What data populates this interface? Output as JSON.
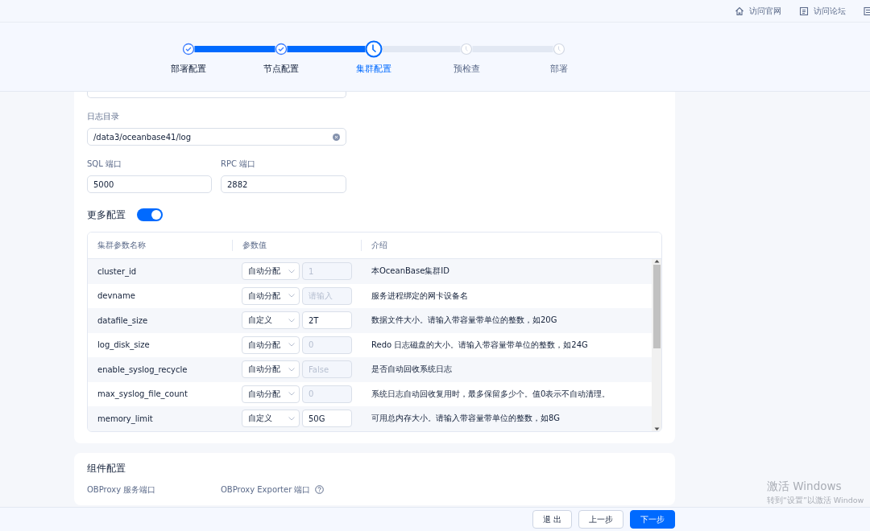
{
  "top_links": [
    {
      "label": "访问官网"
    },
    {
      "label": "访问论坛"
    }
  ],
  "steps": [
    {
      "label": "部署配置",
      "completed": true,
      "selected": false
    },
    {
      "label": "节点配置",
      "completed": true,
      "selected": false
    },
    {
      "label": "集群配置",
      "completed": false,
      "selected": true
    },
    {
      "label": "预检查",
      "completed": false,
      "selected": false
    },
    {
      "label": "部署",
      "completed": false,
      "selected": false
    }
  ],
  "cluster_form": {
    "log_dir": {
      "label": "日志目录",
      "value": "/data3/oceanbase41/log"
    },
    "sql_port": {
      "label": "SQL 端口",
      "value": "5000"
    },
    "rpc_port": {
      "label": "RPC 端口",
      "value": "2882"
    },
    "more_config": {
      "label": "更多配置",
      "on": true
    }
  },
  "params_table": {
    "columns": [
      "集群参数名称",
      "参数值",
      "介绍"
    ],
    "rows": [
      {
        "name": "cluster_id",
        "mode": "自动分配",
        "value": "1",
        "disabled": true,
        "description": "本OceanBase集群ID"
      },
      {
        "name": "devname",
        "mode": "自动分配",
        "placeholder": "请输入",
        "disabled": true,
        "description": "服务进程绑定的网卡设备名"
      },
      {
        "name": "datafile_size",
        "mode": "自定义",
        "value": "2T",
        "disabled": false,
        "description": "数据文件大小。请输入带容量带单位的整数，如20G"
      },
      {
        "name": "log_disk_size",
        "mode": "自动分配",
        "value": "0",
        "disabled": true,
        "description": "Redo 日志磁盘的大小。请输入带容量带单位的整数，如24G"
      },
      {
        "name": "enable_syslog_recycle",
        "mode": "自动分配",
        "value": "False",
        "disabled": true,
        "description": "是否自动回收系统日志"
      },
      {
        "name": "max_syslog_file_count",
        "mode": "自动分配",
        "value": "0",
        "disabled": true,
        "description": "系统日志自动回收复用时，最多保留多少个。值0表示不自动清理。"
      },
      {
        "name": "memory_limit",
        "mode": "自定义",
        "value": "50G",
        "disabled": false,
        "description": "可用总内存大小。请输入带容量带单位的整数，如8G"
      }
    ]
  },
  "component_config": {
    "title": "组件配置",
    "fields": [
      {
        "label": "OBProxy 服务端口",
        "help": false
      },
      {
        "label": "OBProxy Exporter 端口",
        "help": true
      }
    ]
  },
  "buttons": [
    {
      "label": "退 出",
      "kind": "default"
    },
    {
      "label": "上一步",
      "kind": "default"
    },
    {
      "label": "下一步",
      "kind": "primary"
    }
  ],
  "windows_notice": {
    "title": "激活 Windows",
    "subtitle": "转到“设置”以激活 Window"
  }
}
